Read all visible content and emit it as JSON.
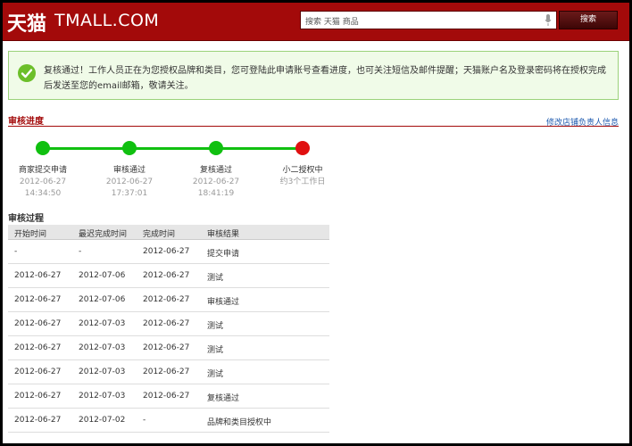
{
  "header": {
    "logo_cn": "天猫",
    "logo_en": "TMALL.COM",
    "search_placeholder": "搜索 天猫 商品",
    "search_button": "搜索"
  },
  "notice": {
    "text": "复核通过！工作人员正在为您授权品牌和类目，您可登陆此申请账号查看进度，也可关注短信及邮件提醒；天猫账户名及登录密码将在授权完成后发送至您的email邮箱，敬请关注。"
  },
  "progress": {
    "title": "审核进度",
    "link": "修改店铺负责人信息",
    "colors": {
      "done": "#10c010",
      "current": "#e01010",
      "track": "#10c010"
    },
    "steps": [
      {
        "name": "商家提交申请",
        "date": "2012-06-27",
        "time": "14:34:50",
        "status": "done"
      },
      {
        "name": "审核通过",
        "date": "2012-06-27",
        "time": "17:37:01",
        "status": "done"
      },
      {
        "name": "复核通过",
        "date": "2012-06-27",
        "time": "18:41:19",
        "status": "done"
      },
      {
        "name": "小二授权中",
        "date": "约3个工作日",
        "time": "",
        "status": "current"
      }
    ]
  },
  "process": {
    "title": "审核过程",
    "columns": [
      "开始时间",
      "最迟完成时间",
      "完成时间",
      "审核结果"
    ],
    "rows": [
      [
        "-",
        "-",
        "2012-06-27",
        "提交申请"
      ],
      [
        "2012-06-27",
        "2012-07-06",
        "2012-06-27",
        "测试"
      ],
      [
        "2012-06-27",
        "2012-07-06",
        "2012-06-27",
        "审核通过"
      ],
      [
        "2012-06-27",
        "2012-07-03",
        "2012-06-27",
        "测试"
      ],
      [
        "2012-06-27",
        "2012-07-03",
        "2012-06-27",
        "测试"
      ],
      [
        "2012-06-27",
        "2012-07-03",
        "2012-06-27",
        "测试"
      ],
      [
        "2012-06-27",
        "2012-07-03",
        "2012-06-27",
        "复核通过"
      ],
      [
        "2012-06-27",
        "2012-07-02",
        "-",
        "品牌和类目授权中"
      ]
    ]
  }
}
